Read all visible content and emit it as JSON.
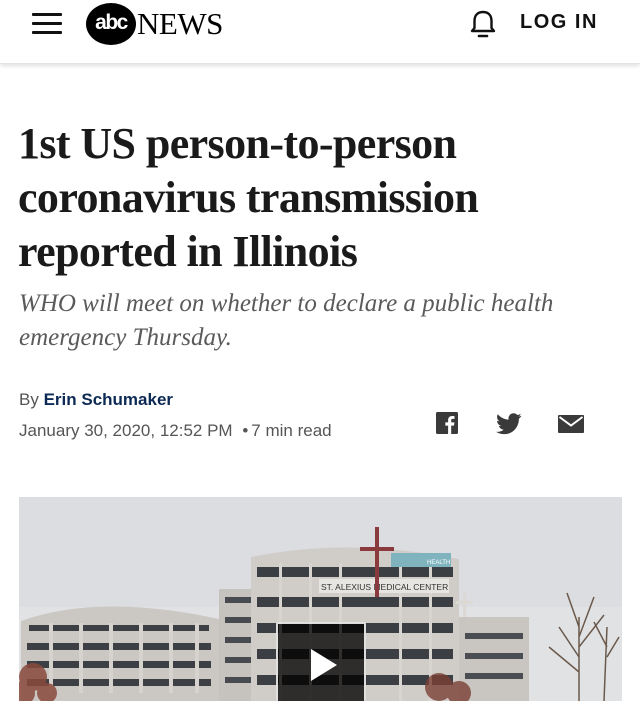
{
  "header": {
    "logo_mark": "abc",
    "logo_text": "NEWS",
    "login_label": "LOG IN",
    "menu_icon": "hamburger-menu-icon",
    "bell_icon": "bell-icon"
  },
  "article": {
    "headline": "1st US person-to-person coronavirus transmission reported in Illinois",
    "subheadline": "WHO will meet on whether to declare a public health emergency Thursday.",
    "byline_prefix": "By",
    "author": "Erin Schumaker",
    "date": "January 30, 2020, 12:52 PM",
    "separator": "•",
    "read_time": "7 min read"
  },
  "share": {
    "icons": [
      "facebook-icon",
      "twitter-icon",
      "email-icon"
    ]
  },
  "hero": {
    "sign_text": "ST. ALEXIUS MEDICAL CENTER",
    "corner_sign": "HEALTH",
    "play_icon": "play-icon"
  },
  "colors": {
    "author_link": "#0d2a55",
    "headline": "#1a1a1a",
    "subheadline": "#5a5a5a",
    "meta": "#555555"
  }
}
